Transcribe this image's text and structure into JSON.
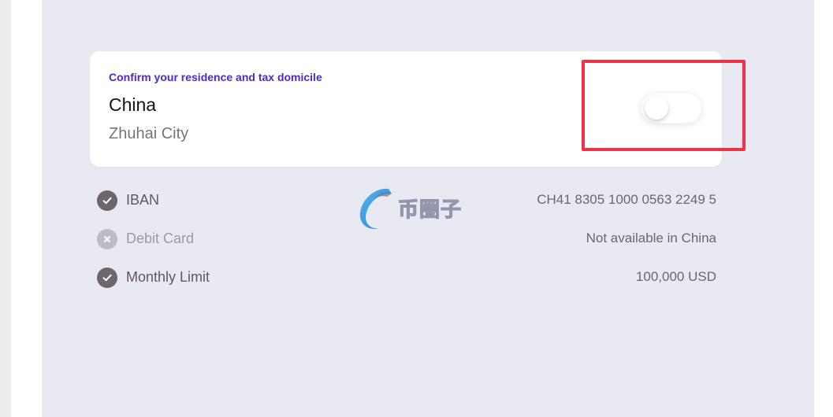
{
  "residence_card": {
    "eyebrow": "Confirm your residence and tax domicile",
    "country": "China",
    "city": "Zhuhai City",
    "toggle_on": false
  },
  "features": [
    {
      "label": "IBAN",
      "value": "CH41 8305 1000 0563 2249 5",
      "available": true,
      "icon": "check-icon"
    },
    {
      "label": "Debit Card",
      "value": "Not available in China",
      "available": false,
      "icon": "cross-icon"
    },
    {
      "label": "Monthly Limit",
      "value": "100,000 USD",
      "available": true,
      "icon": "check-icon"
    }
  ],
  "watermark": {
    "text": "币圈子"
  },
  "colors": {
    "accent": "#4a2bc6",
    "highlight": "#f03246",
    "panel_bg": "#e9e9f2",
    "check_bg": "#6d6670",
    "cross_bg": "#bdbbc6"
  }
}
